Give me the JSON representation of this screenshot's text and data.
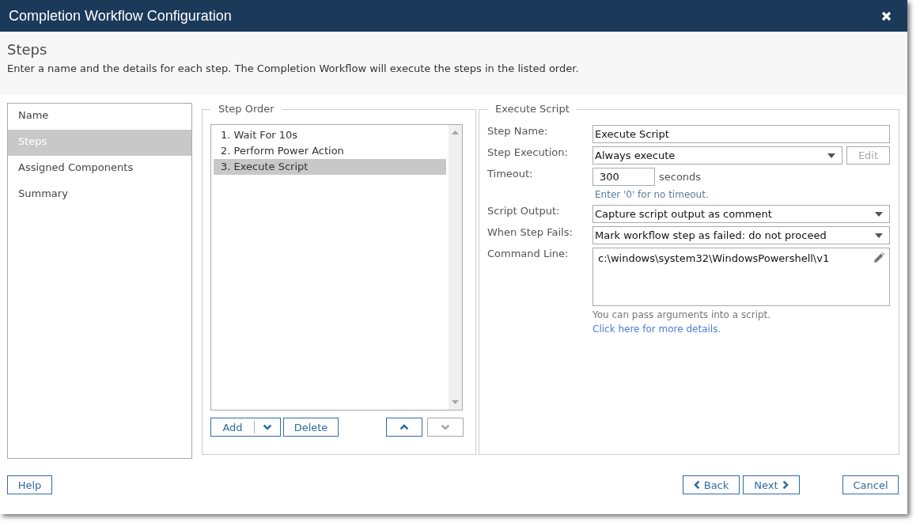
{
  "window": {
    "title": "Completion Workflow Configuration"
  },
  "header": {
    "title": "Steps",
    "description": "Enter a name and the details for each step. The Completion Workflow will execute the steps in the listed order."
  },
  "nav": {
    "items": [
      {
        "label": "Name",
        "selected": false
      },
      {
        "label": "Steps",
        "selected": true
      },
      {
        "label": "Assigned Components",
        "selected": false
      },
      {
        "label": "Summary",
        "selected": false
      }
    ]
  },
  "step_order": {
    "legend": "Step Order",
    "steps": [
      {
        "label": "1. Wait For 10s",
        "selected": false
      },
      {
        "label": "2. Perform Power Action",
        "selected": false
      },
      {
        "label": "3. Execute Script",
        "selected": true
      }
    ],
    "buttons": [
      {
        "kind": "split",
        "label": "Add",
        "disabled": false
      },
      {
        "kind": "text",
        "label": "Delete",
        "disabled": false
      },
      {
        "kind": "up",
        "disabled": false
      },
      {
        "kind": "down",
        "disabled": true
      }
    ]
  },
  "details": {
    "legend": "Execute Script",
    "fields": [
      {
        "kind": "text",
        "label": "Step Name:",
        "value": "Execute Script"
      },
      {
        "kind": "select",
        "label": "Step Execution:",
        "value": "Always execute",
        "button": {
          "label": "Edit",
          "disabled": true
        }
      },
      {
        "kind": "number",
        "label": "Timeout:",
        "value": "300",
        "unit": "seconds",
        "notes": [
          {
            "kind": "hint",
            "text": "Enter '0' for no timeout."
          }
        ]
      },
      {
        "kind": "select",
        "label": "Script Output:",
        "value": "Capture script output as comment"
      },
      {
        "kind": "select",
        "label": "When Step Fails:",
        "value": "Mark workflow step as failed: do not proceed"
      },
      {
        "kind": "textarea",
        "label": "Command Line:",
        "value": "c:\\windows\\system32\\WindowsPowershell\\v1",
        "notes": [
          {
            "kind": "text",
            "text": "You can pass arguments into a script."
          },
          {
            "kind": "link",
            "text": "Click here for more details."
          }
        ]
      }
    ]
  },
  "footer": {
    "help": {
      "label": "Help"
    },
    "navigation": [
      {
        "kind": "prev",
        "label": "Back"
      },
      {
        "kind": "next",
        "label": "Next"
      }
    ],
    "cancel": {
      "label": "Cancel"
    }
  }
}
